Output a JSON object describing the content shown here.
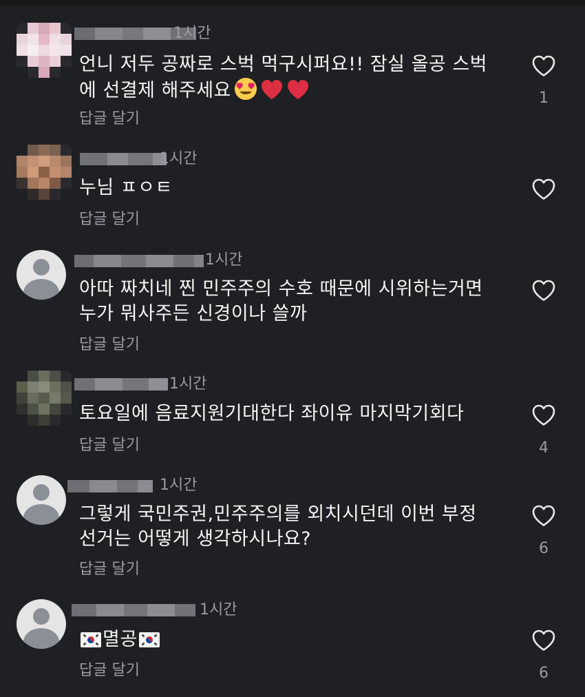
{
  "comments": [
    {
      "time": "1시간",
      "text": "언니 저두 공짜로 스벅 먹구시퍼요!! 잠실 올공 스벅\n에 선결제 해주세요",
      "reply_label": "답글 달기",
      "likes": "1",
      "emoji": [
        "heart-eyes-emoji",
        "red-heart-emoji",
        "red-heart-emoji"
      ]
    },
    {
      "time": "1시간",
      "text": "누님 ㅍㅇㅌ",
      "reply_label": "답글 달기",
      "likes": ""
    },
    {
      "time": "1시간",
      "text": "아따 짜치네 찐 민주주의 수호 때문에 시위하는거면\n누가 뭐사주든 신경이나 쓸까",
      "reply_label": "답글 달기",
      "likes": ""
    },
    {
      "time": "1시간",
      "text": "토요일에 음료지원기대한다 좌이유 마지막기회다",
      "reply_label": "답글 달기",
      "likes": "4"
    },
    {
      "time": "1시간",
      "text": "그렇게 국민주권,민주주의를 외치시던데 이번 부정\n선거는 어떻게 생각하시나요?",
      "reply_label": "답글 달기",
      "likes": "6"
    },
    {
      "time": "1시간",
      "text": "멸공",
      "reply_label": "답글 달기",
      "likes": "6",
      "emoji": [
        "korea-flag-emoji",
        "korea-flag-emoji"
      ]
    }
  ],
  "colors": {
    "background": "#1f2023",
    "text": "#f4f4f4",
    "muted": "#9a9ca1"
  },
  "icons": [
    "heart-outline-icon",
    "default-avatar-icon"
  ]
}
